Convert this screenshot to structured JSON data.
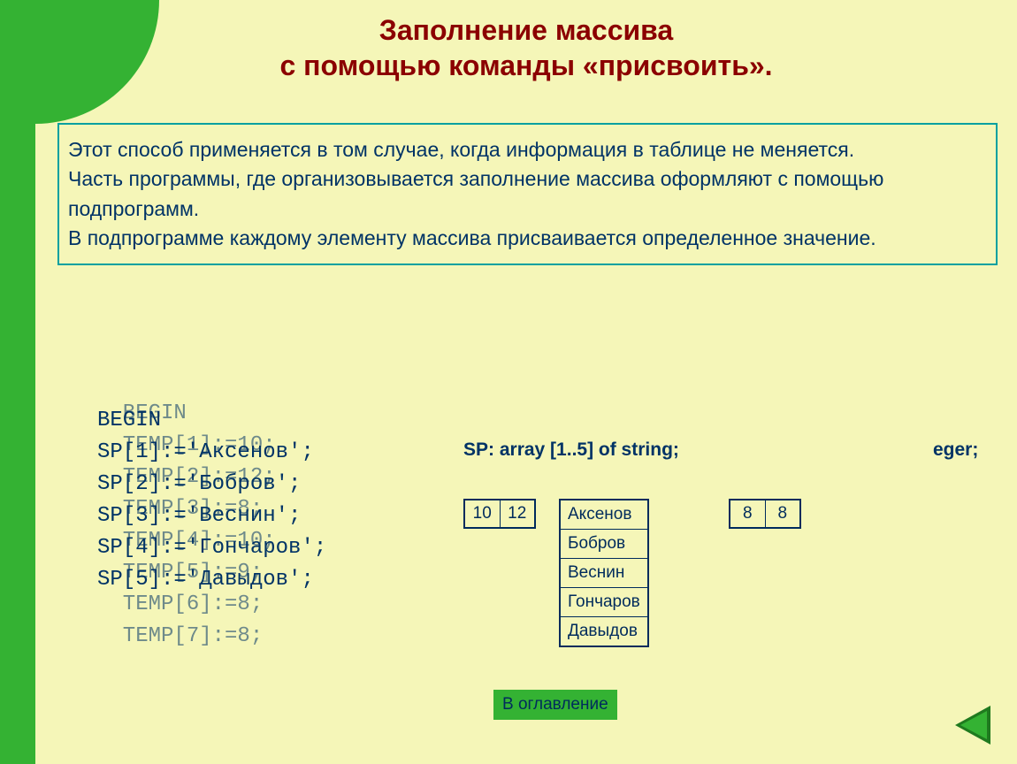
{
  "title_line1": "Заполнение массива",
  "title_line2": "с  помощью команды «присвоить».",
  "description": "Этот способ применяется в том случае, когда информация в таблице не меняется.\nЧасть программы, где организовывается заполнение массива оформляют с помощью подпрограмм.\nВ подпрограмме  каждому элементу массива присваивается определенное значение.",
  "code_back": "  BEGIN\n  TEMP[1]:=10;\n  TEMP[2]:=12;\n  TEMP[3]:=8;\n  TEMP[4]:=10;\n  TEMP[5]:=9;\n  TEMP[6]:=8;\n  TEMP[7]:=8;",
  "code_front": "BEGIN\nSP[1]:='Аксенов';\nSP[2]:='Бобров';\nSP[3]:='Веснин';\nSP[4]:='Гончаров';\nSP[5]:='Давыдов';",
  "decl_back": "eger;",
  "decl_front": "SP:  array [1..5] of string;",
  "row_nums_left": [
    "10",
    "12"
  ],
  "row_nums_right": [
    "8",
    "8"
  ],
  "list_center": [
    "Аксенов",
    "Бобров",
    "Веснин",
    "Гончаров",
    "Давыдов"
  ],
  "toc_button": "В оглавление"
}
